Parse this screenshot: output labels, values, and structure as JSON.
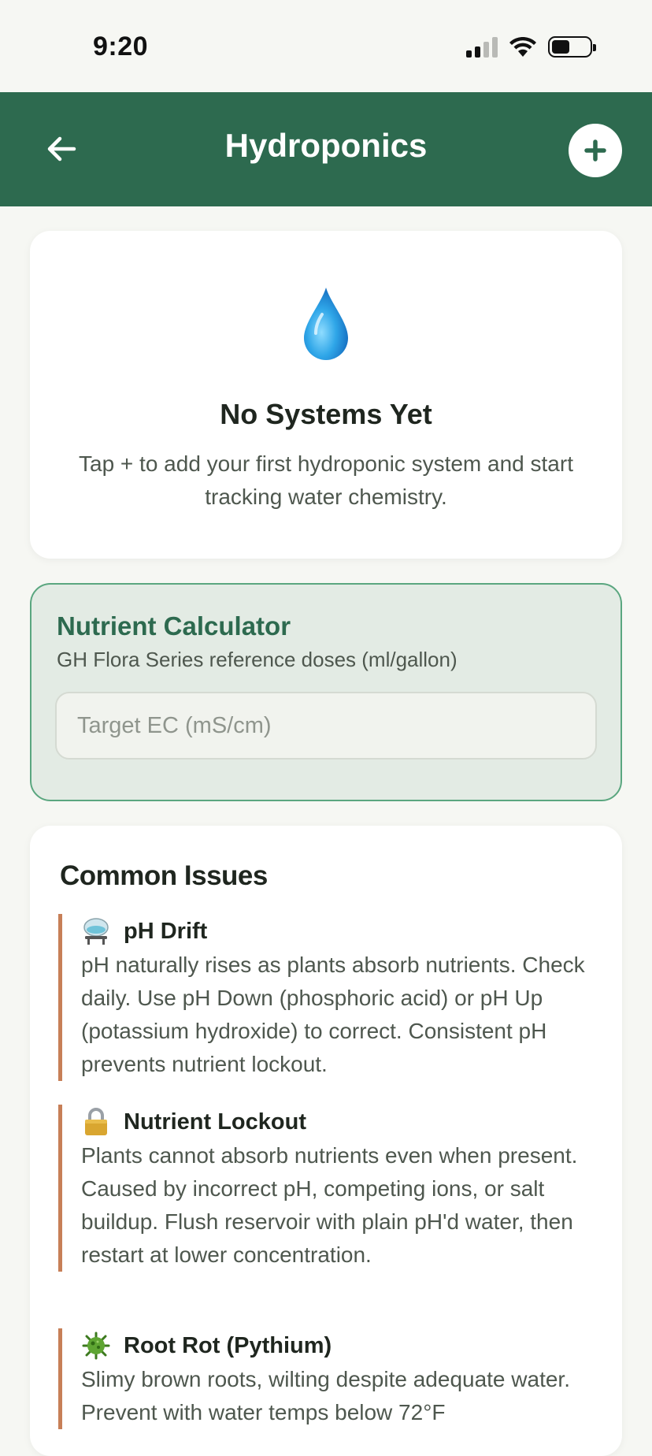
{
  "status": {
    "time": "9:20"
  },
  "appbar": {
    "title": "Hydroponics"
  },
  "empty_state": {
    "title": "No Systems Yet",
    "description": "Tap + to add your first hydroponic system and start tracking water chemistry."
  },
  "calculator": {
    "title": "Nutrient Calculator",
    "subtitle": "GH Flora Series reference doses (ml/gallon)",
    "input_placeholder": "Target EC (mS/cm)"
  },
  "issues": {
    "title": "Common Issues",
    "items": [
      {
        "icon": "chemistry-icon",
        "name": "pH Drift",
        "text": "pH naturally rises as plants absorb nutrients. Check daily. Use pH Down (phosphoric acid) or pH Up (potassium hydroxide) to correct. Consistent pH prevents nutrient lockout."
      },
      {
        "icon": "lock-icon",
        "name": "Nutrient Lockout",
        "text": "Plants cannot absorb nutrients even when present. Caused by incorrect pH, competing ions, or salt buildup. Flush reservoir with plain pH'd water, then restart at lower concentration."
      },
      {
        "icon": "microbe-icon",
        "name": "Root Rot (Pythium)",
        "text": "Slimy brown roots, wilting despite adequate water. Prevent with water temps below 72°F"
      }
    ]
  },
  "colors": {
    "primary": "#2d6a4f",
    "accent_border": "#c77f57",
    "calc_bg": "#e3ebe4",
    "page_bg": "#f6f7f3"
  }
}
